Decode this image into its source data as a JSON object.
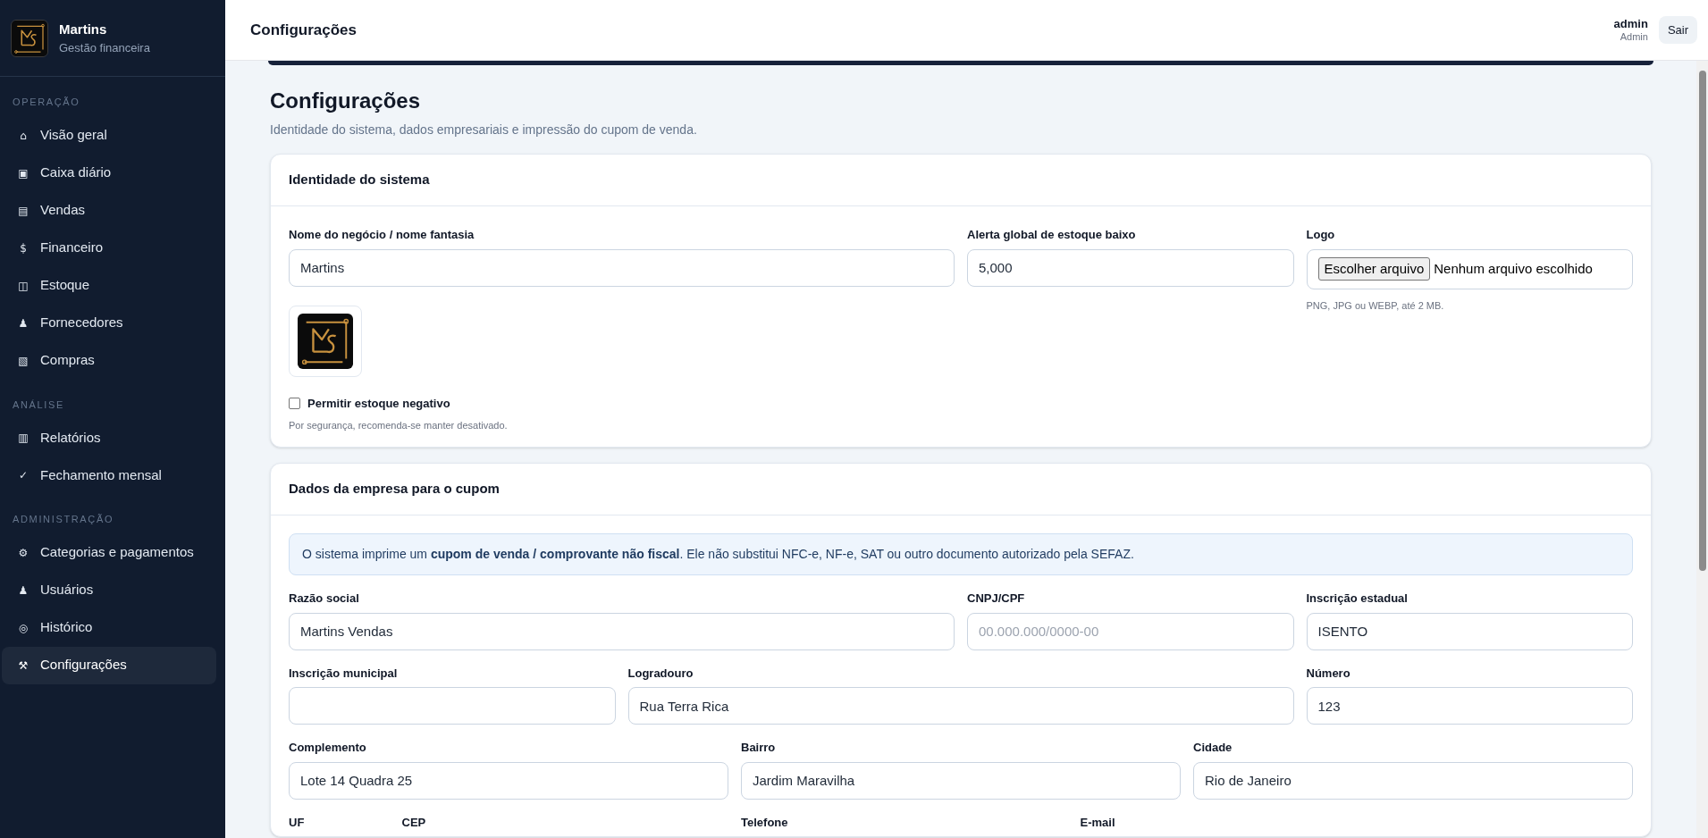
{
  "sidebar": {
    "brand": {
      "name": "Martins",
      "subtitle": "Gestão financeira"
    },
    "sections": [
      {
        "title": "OPERAÇÃO",
        "items": [
          {
            "icon": "⌂",
            "label": "Visão geral",
            "selected": false
          },
          {
            "icon": "▣",
            "label": "Caixa diário",
            "selected": false
          },
          {
            "icon": "▤",
            "label": "Vendas",
            "selected": false
          },
          {
            "icon": "$",
            "label": "Financeiro",
            "selected": false
          },
          {
            "icon": "◫",
            "label": "Estoque",
            "selected": false
          },
          {
            "icon": "♟",
            "label": "Fornecedores",
            "selected": false
          },
          {
            "icon": "▧",
            "label": "Compras",
            "selected": false
          }
        ]
      },
      {
        "title": "ANÁLISE",
        "items": [
          {
            "icon": "▥",
            "label": "Relatórios",
            "selected": false
          },
          {
            "icon": "✓",
            "label": "Fechamento mensal",
            "selected": false
          }
        ]
      },
      {
        "title": "ADMINISTRAÇÃO",
        "items": [
          {
            "icon": "⚙",
            "label": "Categorias e pagamentos",
            "selected": false
          },
          {
            "icon": "♟",
            "label": "Usuários",
            "selected": false
          },
          {
            "icon": "◎",
            "label": "Histórico",
            "selected": false
          },
          {
            "icon": "⚒",
            "label": "Configurações",
            "selected": true
          }
        ]
      }
    ]
  },
  "header": {
    "title": "Configurações",
    "user": {
      "name": "admin",
      "role": "Admin"
    },
    "logout_button": "Sair"
  },
  "page": {
    "title": "Configurações",
    "subtitle": "Identidade do sistema, dados empresariais e impressão do cupom de venda."
  },
  "identity_card": {
    "title": "Identidade do sistema",
    "fields": [
      {
        "kind": "input",
        "label": "Nome do negócio / nome fantasia",
        "value": "Martins"
      },
      {
        "kind": "input",
        "label": "Alerta global de estoque baixo",
        "value": "5,000"
      },
      {
        "kind": "file",
        "label": "Logo",
        "button": "Escolher arquivo",
        "status": "Nenhum arquivo escolhido",
        "hint": "PNG, JPG ou WEBP, até 2 MB."
      }
    ],
    "checkbox": {
      "label": "Permitir estoque negativo",
      "checked": false,
      "hint": "Por segurança, recomenda-se manter desativado."
    }
  },
  "company_card": {
    "title": "Dados da empresa para o cupom",
    "note": "O sistema imprime um **cupom de venda / comprovante não fiscal**. Ele não substitui NFC-e, NF-e, SAT ou outro documento autorizado pela SEFAZ.",
    "rows": [
      [
        {
          "kind": "input",
          "label": "Razão social",
          "value": "Martins Vendas"
        },
        {
          "kind": "input",
          "label": "CNPJ/CPF",
          "placeholder": "00.000.000/0000-00"
        },
        {
          "kind": "input",
          "label": "Inscrição estadual",
          "value": "ISENTO"
        }
      ],
      [
        {
          "kind": "input",
          "label": "Inscrição municipal"
        },
        {
          "kind": "input",
          "label": "Logradouro",
          "value": "Rua Terra Rica"
        },
        {
          "kind": "input",
          "label": "Número",
          "value": "123"
        }
      ],
      [
        {
          "kind": "input",
          "label": "Complemento",
          "value": "Lote 14 Quadra 25"
        },
        {
          "kind": "input",
          "label": "Bairro",
          "value": "Jardim Maravilha"
        },
        {
          "kind": "input",
          "label": "Cidade",
          "value": "Rio de Janeiro"
        }
      ],
      [
        {
          "kind": "label",
          "label": "UF"
        },
        {
          "kind": "label",
          "label": "CEP"
        },
        {
          "kind": "label",
          "label": "Telefone"
        },
        {
          "kind": "label",
          "label": "E-mail"
        }
      ]
    ]
  }
}
